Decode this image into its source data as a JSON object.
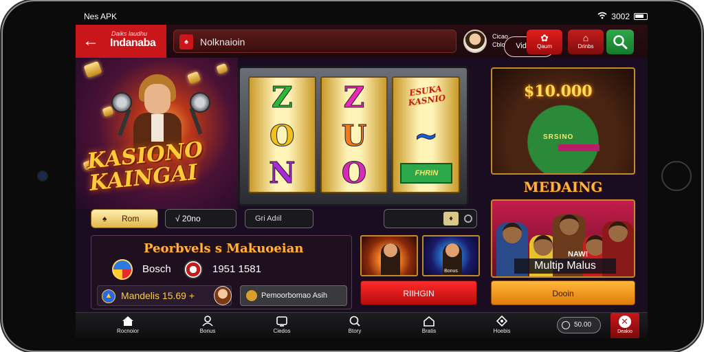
{
  "status_bar": {
    "left_text": "Nes APK",
    "right_text": "3002"
  },
  "header": {
    "brand_small": "Daiks laudhu",
    "brand": "Indanaba",
    "search_text": "Nolknaioin",
    "video_button": "Vidtoo",
    "user_line1": "Cicao",
    "user_line2": "Cblo",
    "btn1_label": "Qaum",
    "btn2_label": "Drinbs"
  },
  "hero": {
    "title_line1": "KASIONO",
    "title_line2": "KAINGAI"
  },
  "slot": {
    "reel1": [
      "Z",
      "O",
      "N"
    ],
    "reel2": [
      "Z",
      "U",
      "O"
    ],
    "reel3_top": "ESUKA KASNIO",
    "reel3_tag": "FHRIN"
  },
  "right": {
    "jackpot": "$10.000",
    "table_label": "SRSINO",
    "heading": "MEDAING",
    "multi_label": "Multip Malus",
    "multi_sub": "NAW!"
  },
  "controls": {
    "home_label": "Rom",
    "bet_label": "√ 20no",
    "ask_label": "Gri Adıil"
  },
  "panel": {
    "title": "Peorbvels s Makuoeian",
    "search_label": "Bosch",
    "value": "1951 1581",
    "left_row_text": "Mandelis 15.69 +",
    "right_row_text": "Pemoorbomao Asih"
  },
  "thumbs": {
    "t2_label": "Bonus"
  },
  "ctas": {
    "red_label": "RIIHGIN",
    "orange_label": "Dooin"
  },
  "nav": {
    "items": [
      {
        "label": "Rocnoior"
      },
      {
        "label": "Bonus"
      },
      {
        "label": "Ciedos"
      },
      {
        "label": "Btory"
      },
      {
        "label": "Bratis"
      },
      {
        "label": "Hoebis"
      }
    ],
    "balance": "50.00",
    "active_label": "Deakio"
  },
  "colors": {
    "accent_red": "#c8161a",
    "accent_green": "#2fa84a",
    "accent_gold": "#ffb33a"
  }
}
